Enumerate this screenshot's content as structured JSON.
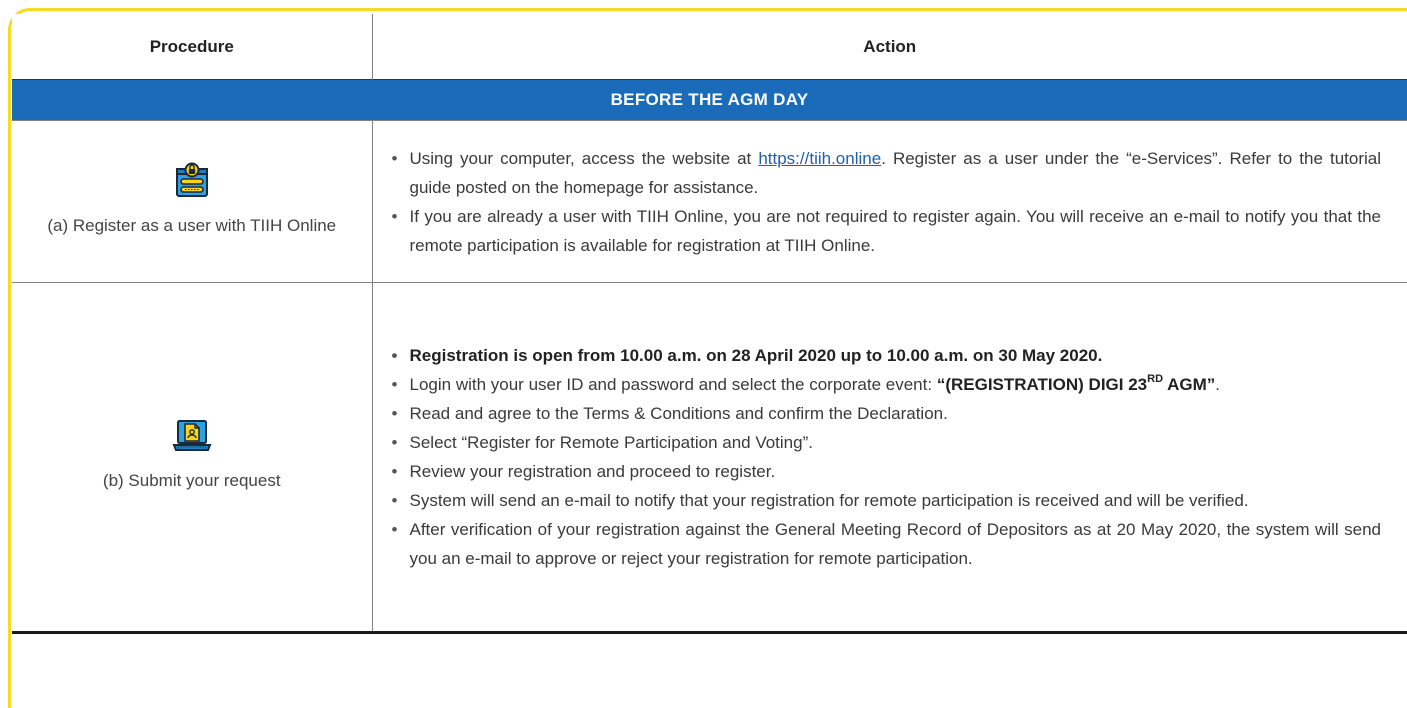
{
  "headers": {
    "procedure": "Procedure",
    "action": "Action"
  },
  "section": {
    "title": "BEFORE THE AGM DAY"
  },
  "rows": [
    {
      "procedure_label": "(a) Register as a user with TIIH Online",
      "icon": "registration-form-lock-icon",
      "actions": {
        "item0": {
          "pre": "Using your computer, access the website at ",
          "link": "https://tiih.online",
          "post": ". Register as a user under the “e-Services”. Refer to the tutorial guide posted on the homepage for assistance."
        },
        "item1": "If you are already a user with TIIH Online, you are not required to register again. You will receive an e-mail to notify you that the remote participation is available for registration at TIIH Online."
      }
    },
    {
      "procedure_label": "(b) Submit your request",
      "icon": "laptop-document-icon",
      "actions": {
        "item0": "Registration is open from 10.00 a.m. on 28 April 2020 up to 10.00 a.m. on 30 May 2020.",
        "item1": {
          "pre": "Login with your user ID and password and select the corporate event: ",
          "event_a": "“(REGISTRATION) DIGI 23",
          "event_sup": "RD",
          "event_b": " AGM”",
          "post": "."
        },
        "item2": "Read and agree to the Terms & Conditions and confirm the Declaration.",
        "item3": "Select “Register for Remote Participation and Voting”.",
        "item4": "Review your registration and proceed to register.",
        "item5": "System will send an e-mail to notify that your registration for remote participation is received and will be verified.",
        "item6": "After verification of your registration against the General Meeting Record of Depositors as at 20 May 2020, the system will send you an e-mail to approve or reject your registration for remote participation."
      }
    }
  ],
  "colors": {
    "section_bg": "#1a6cba",
    "frame": "#f5dc22",
    "link": "#1f5fb0",
    "icon_blue": "#2aa3e0",
    "icon_yellow": "#f8d21b"
  }
}
